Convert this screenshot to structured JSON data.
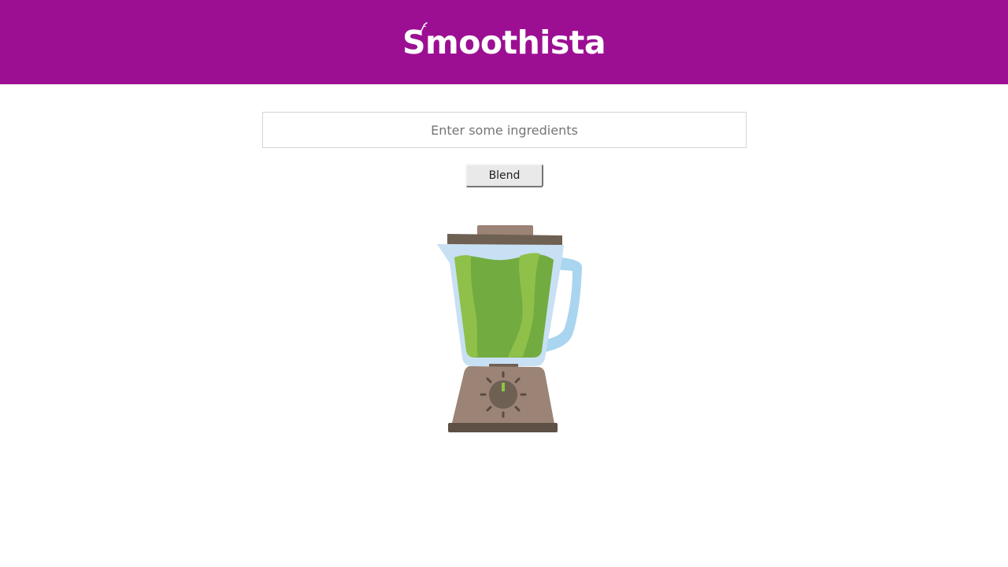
{
  "header": {
    "logo_text": "Smoothista",
    "background_color": "#9c0f93"
  },
  "search": {
    "placeholder": "Enter some ingredients",
    "value": ""
  },
  "actions": {
    "blend_label": "Blend"
  },
  "illustration": {
    "icon": "blender-icon",
    "colors": {
      "jar": "#c8e0f4",
      "handle": "#a9d5f0",
      "smoothie": "#72ab3f",
      "smoothie_highlight": "#8fc04a",
      "base": "#9b8375",
      "lid": "#6e6053",
      "dial": "#6e6053",
      "indicator": "#8dc63f"
    }
  }
}
